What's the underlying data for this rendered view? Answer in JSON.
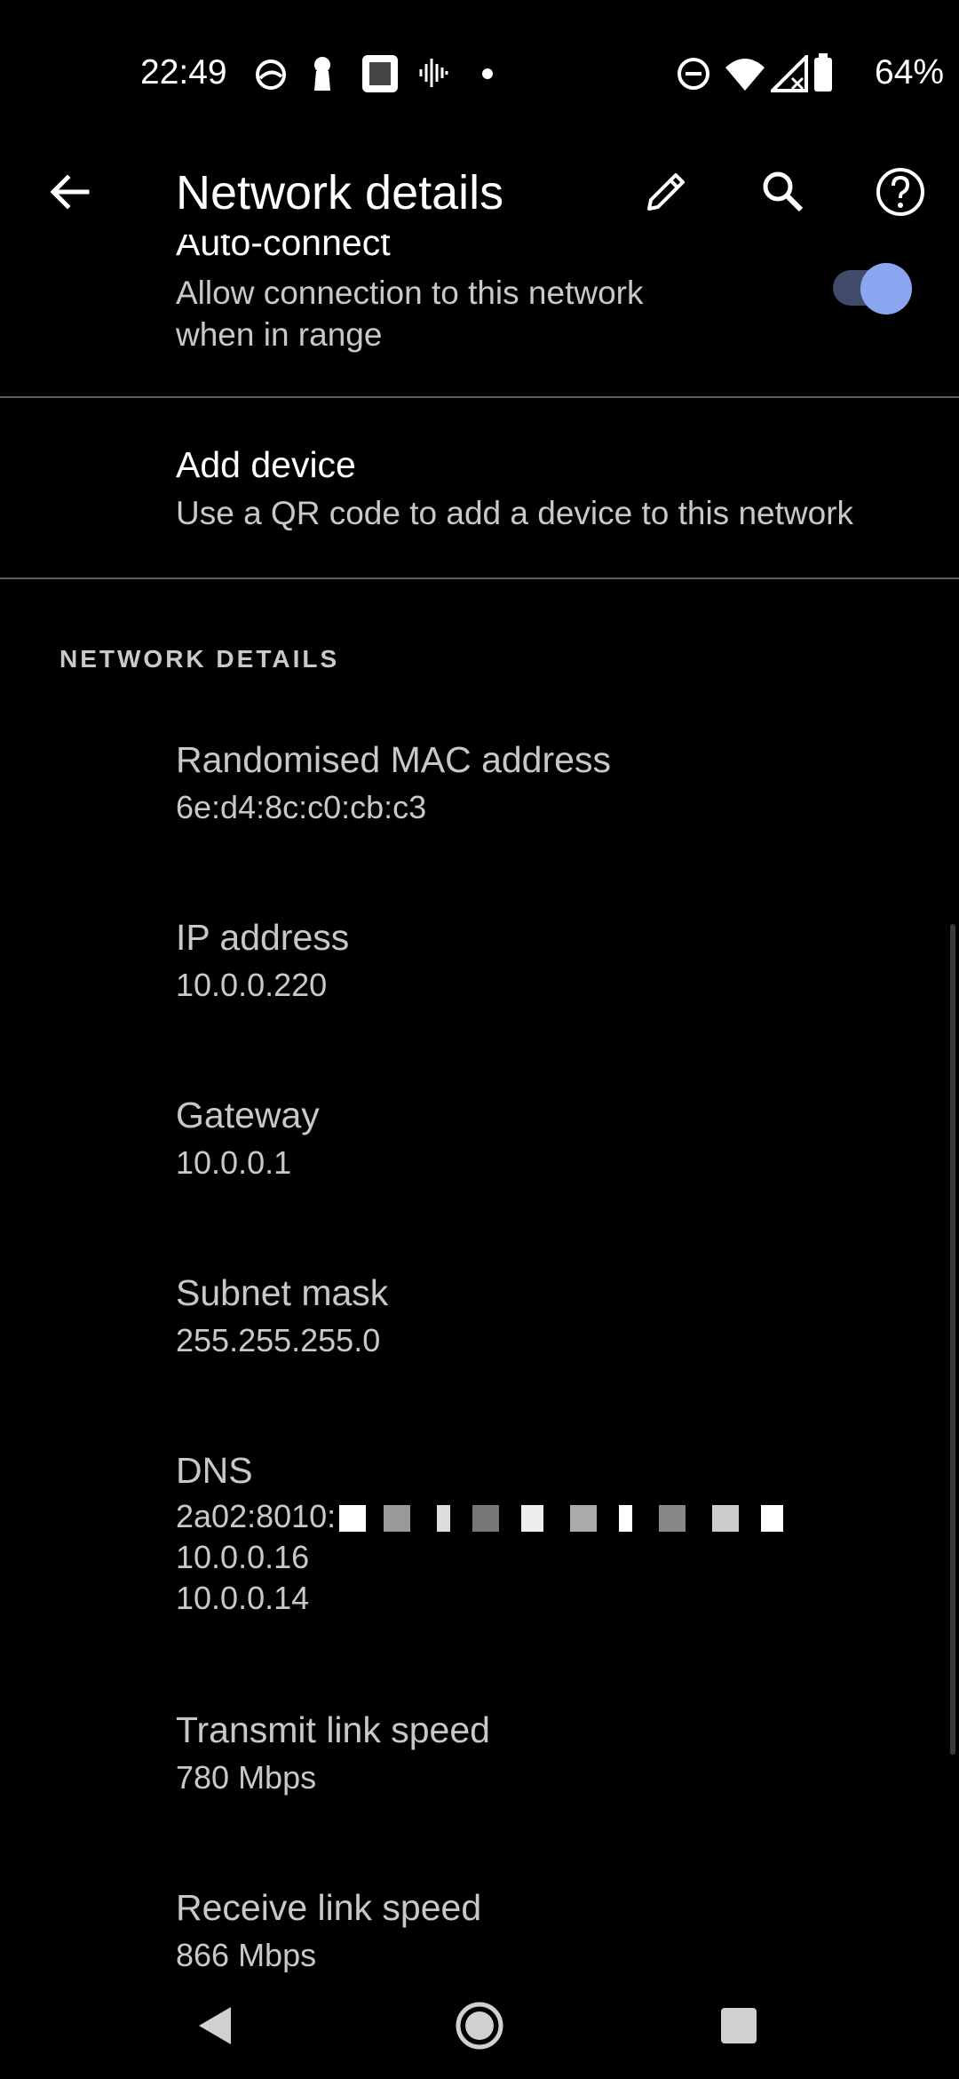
{
  "status_bar": {
    "time": "22:49",
    "battery": "64%",
    "icons": [
      "overlay-icon",
      "keyhole-icon",
      "bible-app-icon",
      "sound-wave-icon",
      "notification-dot-icon",
      "do-not-disturb-icon",
      "wifi-icon",
      "no-signal-icon",
      "battery-icon"
    ]
  },
  "app_bar": {
    "title": "Network details",
    "icons": [
      "back-arrow-icon",
      "edit-pencil-icon",
      "search-icon",
      "help-icon"
    ]
  },
  "auto_connect": {
    "title": "Auto-connect",
    "summary_line1": "Allow connection to this network",
    "summary_line2": "when in range",
    "enabled": true
  },
  "add_device": {
    "title": "Add device",
    "summary": "Use a QR code to add a device to this network"
  },
  "network_details": {
    "header": "NETWORK DETAILS",
    "mac": {
      "label": "Randomised MAC address",
      "value": "6e:d4:8c:c0:cb:c3"
    },
    "ip": {
      "label": "IP address",
      "value": "10.0.0.220"
    },
    "gateway": {
      "label": "Gateway",
      "value": "10.0.0.1"
    },
    "subnet": {
      "label": "Subnet mask",
      "value": "255.255.255.0"
    },
    "dns": {
      "label": "DNS",
      "value_line1": "2a02:8010:",
      "value_line2": "10.0.0.16",
      "value_line3": "10.0.0.14"
    },
    "transmit": {
      "label": "Transmit link speed",
      "value": "780 Mbps"
    },
    "receive": {
      "label": "Receive link speed",
      "value": "866 Mbps"
    }
  },
  "nav_bar": {
    "icons": [
      "back-triangle-icon",
      "home-circle-icon",
      "recents-square-icon"
    ]
  },
  "colors": {
    "background": "#000000",
    "accent": "#8aa6f0",
    "toggle_track": "#3f4b69",
    "divider": "#5c5c5c"
  }
}
